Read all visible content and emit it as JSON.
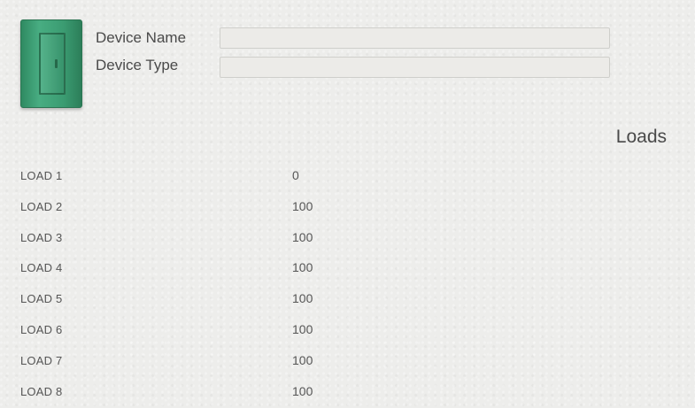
{
  "device": {
    "icon": "green-cabinet-icon",
    "name_label": "Device Name",
    "name_value": "",
    "type_label": "Device Type",
    "type_value": ""
  },
  "loads": {
    "title": "Loads",
    "items": [
      {
        "name": "LOAD 1",
        "value": "0"
      },
      {
        "name": "LOAD 2",
        "value": "100"
      },
      {
        "name": "LOAD 3",
        "value": "100"
      },
      {
        "name": "LOAD 4",
        "value": "100"
      },
      {
        "name": "LOAD 5",
        "value": "100"
      },
      {
        "name": "LOAD 6",
        "value": "100"
      },
      {
        "name": "LOAD 7",
        "value": "100"
      },
      {
        "name": "LOAD 8",
        "value": "100"
      }
    ]
  },
  "colors": {
    "background": "#ededeb",
    "device_green": "#3b9c72",
    "text": "#4a4a4a"
  }
}
